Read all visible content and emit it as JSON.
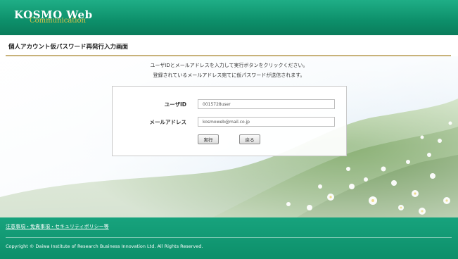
{
  "header": {
    "logo_main": "KOSMO Web",
    "logo_sub": "Communication",
    "color": "#0d8f6a"
  },
  "title_bar": {
    "title": "個人アカウント仮パスワード再発行入力画面"
  },
  "instructions": {
    "line1": "ユーザIDとメールアドレスを入力して実行ボタンをクリックください。",
    "line2": "登録されているメールアドレス宛てに仮パスワードが送信されます。"
  },
  "form": {
    "user_id_label": "ユーザID",
    "user_id_value": "0015728user",
    "email_label": "メールアドレス",
    "email_value": "kosmoweb@mail.co.jp",
    "execute_label": "実行",
    "back_label": "戻る"
  },
  "footer": {
    "link_text": "注意事項・免責事項・セキュリティポリシー等",
    "copyright": "Copyright © Daiwa Institute of Research Business Innovation Ltd. All Rights Reserved."
  }
}
